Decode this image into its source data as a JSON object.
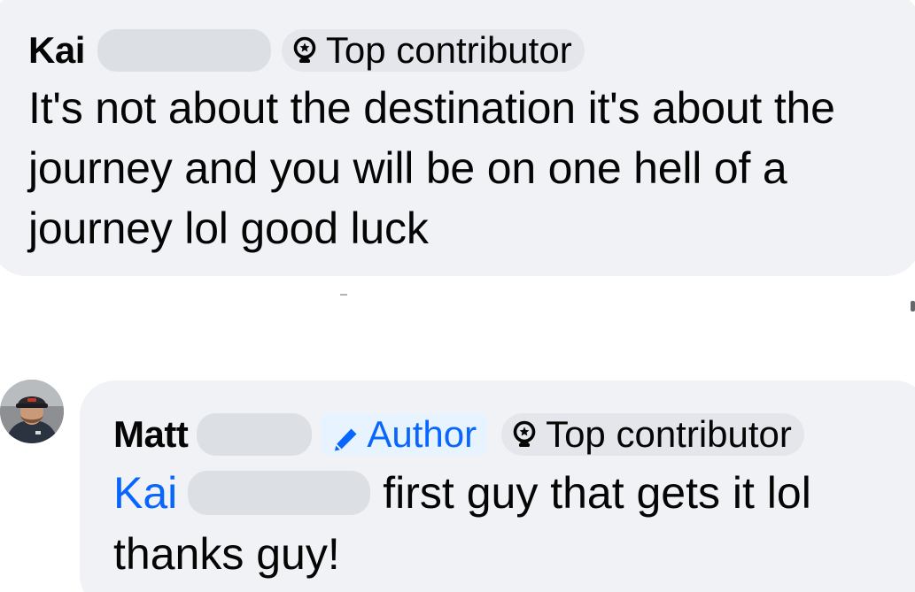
{
  "comments": [
    {
      "author_name": "Kai",
      "badge_label": "Top contributor",
      "text": "It's not about the destination it's about the journey and you will be on one hell of a journey lol good luck"
    }
  ],
  "reply": {
    "author_name": "Matt",
    "author_badge_label": "Author",
    "badge_label": "Top contributor",
    "mention": "Kai",
    "text_line_1": "first guy that gets it lol",
    "text_line_2": "thanks guy!"
  },
  "colors": {
    "bubble": "#f0f2f5",
    "badge_bg": "#e4e6eb",
    "author_badge_bg": "#e7f3ff",
    "accent_blue": "#0866ff",
    "text": "#050505",
    "redaction": "#dcdfe3"
  },
  "icons": {
    "top_contributor": "award-ribbon-icon",
    "author": "pencil-icon"
  }
}
